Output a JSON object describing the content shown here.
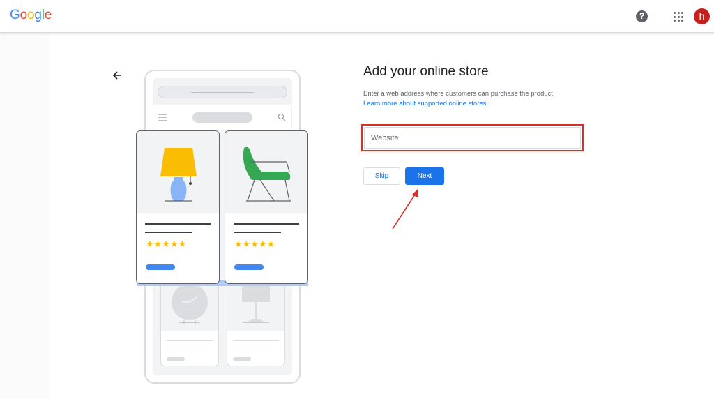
{
  "header": {
    "logo_letters": [
      {
        "ch": "G",
        "color": "#4285F4"
      },
      {
        "ch": "o",
        "color": "#EA4335"
      },
      {
        "ch": "o",
        "color": "#FBBC05"
      },
      {
        "ch": "g",
        "color": "#4285F4"
      },
      {
        "ch": "l",
        "color": "#34A853"
      },
      {
        "ch": "e",
        "color": "#EA4335"
      }
    ],
    "help_glyph": "?",
    "help_icon": "help-circle-icon",
    "apps_icon": "apps-grid-icon",
    "avatar_letter": "h",
    "avatar_color": "#c5221f"
  },
  "illustration": {
    "card_stars": "★★★★★",
    "star_color": "#fbbc04",
    "button_pill_color": "#4285f4",
    "lamp_shade_color": "#fbbc04",
    "lamp_base_color": "#8ab4f8",
    "chair_color": "#34a853"
  },
  "main": {
    "title": "Add your online store",
    "description": "Enter a web address where customers can purchase the product.",
    "learn_more_link": "Learn more about supported online stores",
    "learn_more_suffix": " .",
    "website_input": {
      "value": "",
      "placeholder": "Website"
    },
    "skip_label": "Skip",
    "next_label": "Next",
    "accent_color": "#1a73e8",
    "highlight_color": "#d93025"
  }
}
